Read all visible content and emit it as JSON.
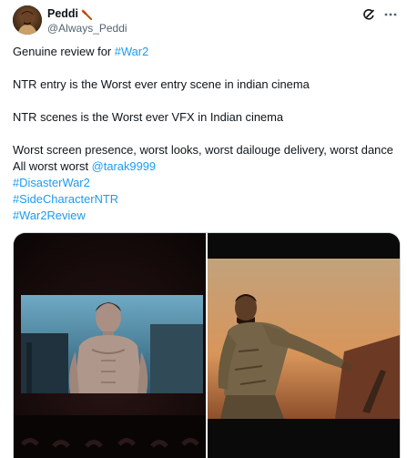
{
  "author": {
    "display_name": "Peddi",
    "handle": "@Always_Peddi",
    "avatar_icon": "profile-photo",
    "name_emoji_icon": "torch-emoji-icon"
  },
  "header_actions": {
    "grok_icon": "grok-icon",
    "more_icon": "more-dots-icon"
  },
  "text": {
    "line1_prefix": "Genuine review for ",
    "line1_hashtag": "#War2",
    "line2": "NTR entry is the Worst ever entry scene in indian cinema",
    "line3": "NTR scenes is the Worst ever VFX in Indian cinema",
    "line4": "Worst screen presence, worst looks, worst dailouge delivery, worst dance All worst worst ",
    "line4_mention": "@tarak9999",
    "hashtag2": "#DisasterWar2",
    "hashtag3": "#SideCharacterNTR",
    "hashtag4": "#War2Review"
  },
  "media": {
    "items": [
      {
        "kind": "photo",
        "subject": "theater-screen-shirtless-man"
      },
      {
        "kind": "photo",
        "subject": "man-in-camo-jacket-posing"
      }
    ]
  },
  "colors": {
    "link": "#1d9bf0",
    "text": "#0f1419",
    "secondary": "#536471",
    "border": "#cfd9de"
  }
}
